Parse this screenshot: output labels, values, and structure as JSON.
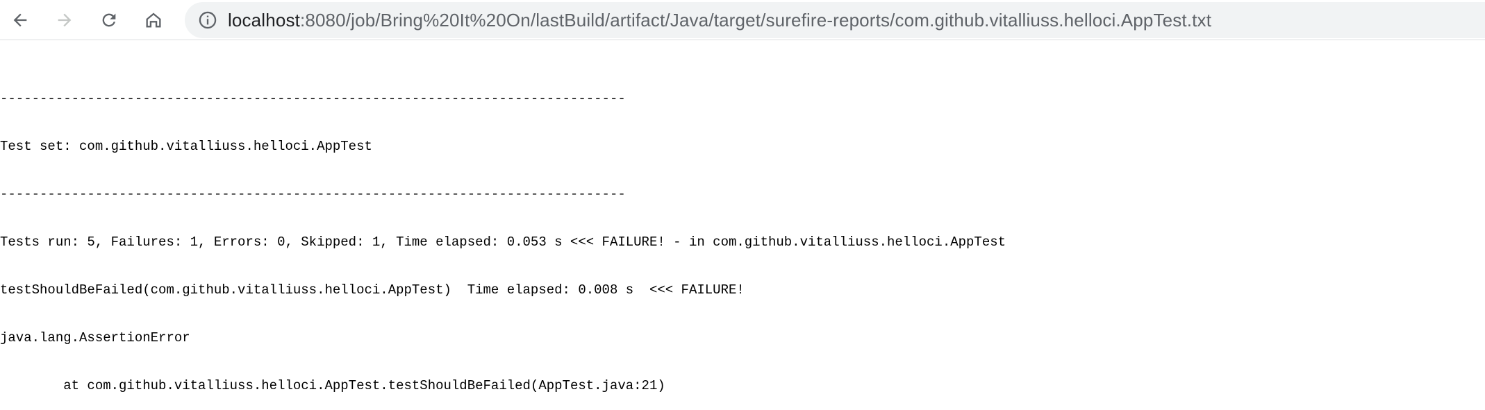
{
  "browser": {
    "url_host": "localhost",
    "url_rest": ":8080/job/Bring%20It%20On/lastBuild/artifact/Java/target/surefire-reports/com.github.vitalliuss.helloci.AppTest.txt",
    "icons": {
      "back": "arrow-left-icon",
      "forward": "arrow-right-icon",
      "reload": "reload-icon",
      "home": "home-icon",
      "info": "info-icon"
    }
  },
  "report": {
    "lines": [
      "-------------------------------------------------------------------------------",
      "Test set: com.github.vitalliuss.helloci.AppTest",
      "-------------------------------------------------------------------------------",
      "Tests run: 5, Failures: 1, Errors: 0, Skipped: 1, Time elapsed: 0.053 s <<< FAILURE! - in com.github.vitalliuss.helloci.AppTest",
      "testShouldBeFailed(com.github.vitalliuss.helloci.AppTest)  Time elapsed: 0.008 s  <<< FAILURE!",
      "java.lang.AssertionError",
      "\tat com.github.vitalliuss.helloci.AppTest.testShouldBeFailed(AppTest.java:21)"
    ]
  },
  "colors": {
    "toolbar_bg": "#ffffff",
    "omnibox_bg": "#f1f3f4",
    "icon_active": "#5f6368",
    "icon_disabled": "#c4c7c5",
    "text": "#000000"
  }
}
